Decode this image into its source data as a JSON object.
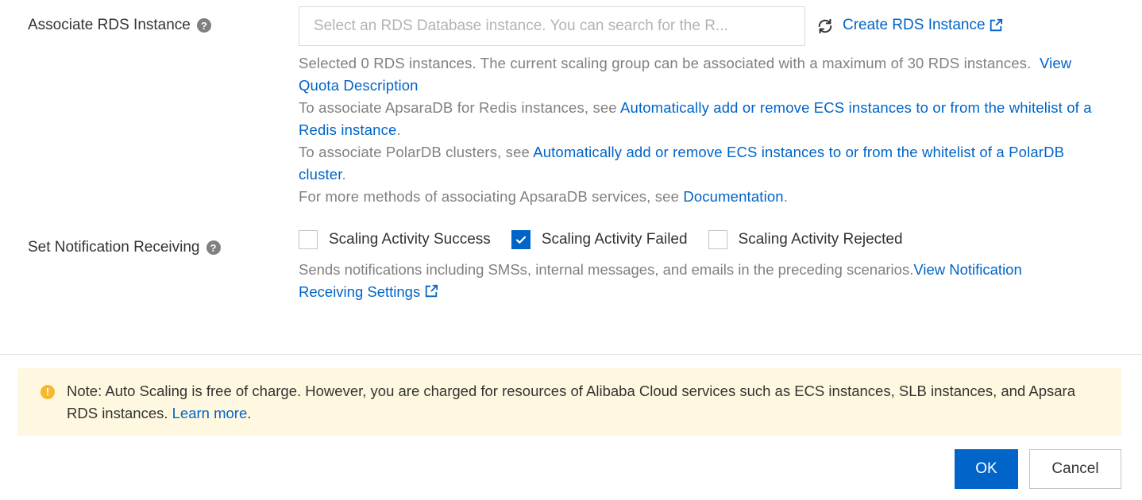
{
  "rds": {
    "label": "Associate RDS Instance",
    "placeholder": "Select an RDS Database instance. You can search for the R...",
    "create_link": "Create RDS Instance",
    "hint_selected": "Selected 0 RDS instances. The current scaling group can be associated with a maximum of 30 RDS instances.",
    "quota_link": "View Quota Description",
    "redis_prefix": "To associate ApsaraDB for Redis instances, see ",
    "redis_link": "Automatically add or remove ECS instances to or from the whitelist of a Redis instance",
    "polar_prefix": "To associate PolarDB clusters, see ",
    "polar_link": "Automatically add or remove ECS instances to or from the whitelist of a PolarDB cluster",
    "more_prefix": "For more methods of associating ApsaraDB services, see ",
    "doc_link": "Documentation",
    "period": "."
  },
  "notification": {
    "label": "Set Notification Receiving",
    "options": [
      {
        "label": "Scaling Activity Success",
        "checked": false
      },
      {
        "label": "Scaling Activity Failed",
        "checked": true
      },
      {
        "label": "Scaling Activity Rejected",
        "checked": false
      }
    ],
    "hint": "Sends notifications including SMSs, internal messages, and emails in the preceding scenarios.",
    "settings_link": "View Notification Receiving Settings"
  },
  "notice": {
    "text": "Note: Auto Scaling is free of charge. However, you are charged for resources of Alibaba Cloud services such as ECS instances, SLB instances, and Apsara RDS instances.",
    "learn_more": "Learn more",
    "period": "."
  },
  "footer": {
    "ok_label": "OK",
    "cancel_label": "Cancel"
  },
  "colors": {
    "accent": "#0064c8",
    "notice_bg": "#fff8e0",
    "warning": "#f5b82e"
  },
  "icons": {
    "help": "help-circle-icon",
    "refresh": "refresh-icon",
    "external": "external-link-icon",
    "warning": "warning-circle-icon",
    "check": "check-icon"
  }
}
